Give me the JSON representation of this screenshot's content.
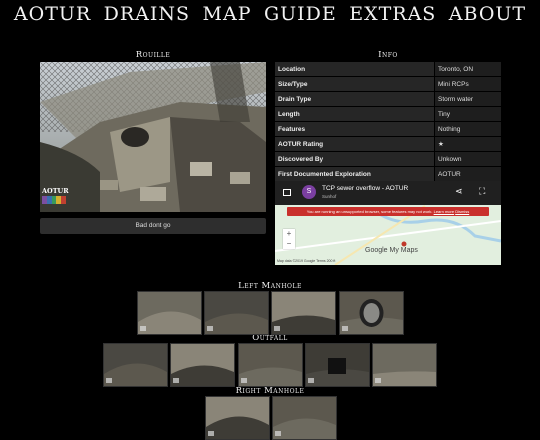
{
  "nav": [
    "AOTUR",
    "DRAINS",
    "MAP",
    "GUIDE",
    "EXTRAS",
    "ABOUT"
  ],
  "hero": {
    "title": "Rouille",
    "caption": "Bad dont go",
    "logo_text": "AOTUR"
  },
  "info": {
    "title": "Info",
    "rows": [
      {
        "label": "Location",
        "value": "Toronto, ON"
      },
      {
        "label": "Size/Type",
        "value": "Mini RCPs"
      },
      {
        "label": "Drain Type",
        "value": "Storm water"
      },
      {
        "label": "Length",
        "value": "Tiny"
      },
      {
        "label": "Features",
        "value": "Nothing"
      },
      {
        "label": "AOTUR Rating",
        "value": "★"
      },
      {
        "label": "Discovered By",
        "value": "Unkown"
      },
      {
        "label": "First Documented Exploration",
        "value": "AOTUR"
      }
    ]
  },
  "map": {
    "avatar_letter": "S",
    "title": "TCP sewer overflow - AOTUR",
    "subtitle": "Sunhof",
    "warning": "You are running an unsupported browser, some features may not work.",
    "warning_link": "Learn more",
    "warning_dismiss": "Dismiss",
    "brand": "Google My Maps",
    "footer": "Map data ©2019 Google   Terms   200 ft",
    "zoom_in": "+",
    "zoom_out": "−"
  },
  "galleries": [
    {
      "title": "Left Manhole",
      "count": 4
    },
    {
      "title": "Outfall",
      "count": 5
    },
    {
      "title": "Right Manhole",
      "count": 2
    }
  ],
  "colors": {
    "background": "#000000",
    "table_key_bg": "#262626",
    "table_value_bg": "#1e1e1e",
    "warning": "#c9302c"
  }
}
